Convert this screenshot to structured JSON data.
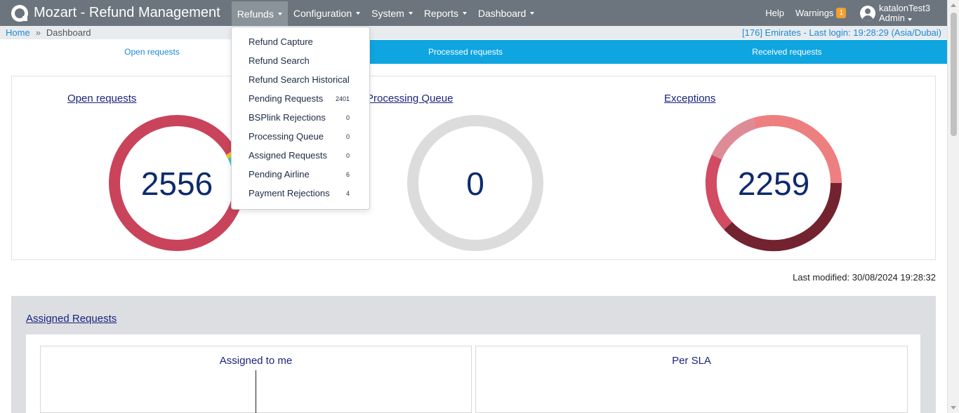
{
  "header": {
    "title": "Mozart - Refund Management",
    "menu": [
      {
        "label": "Refunds",
        "active": true
      },
      {
        "label": "Configuration"
      },
      {
        "label": "System"
      },
      {
        "label": "Reports"
      },
      {
        "label": "Dashboard"
      }
    ],
    "help": "Help",
    "warnings_label": "Warnings",
    "warnings_count": "1",
    "user_name": "katalonTest3",
    "user_role": "Admin"
  },
  "breadcrumb": {
    "home": "Home",
    "separator": "»",
    "current": "Dashboard",
    "login_info": "[176] Emirates - Last login: 19:28:29 (Asia/Dubai)"
  },
  "tabs": [
    "Open requests",
    "Processed requests",
    "Received requests"
  ],
  "refunds_dropdown": [
    {
      "label": "Refund Capture",
      "count": ""
    },
    {
      "label": "Refund Search",
      "count": ""
    },
    {
      "label": "Refund Search Historical",
      "count": ""
    },
    {
      "label": "Pending Requests",
      "count": "2401"
    },
    {
      "label": "BSPlink Rejections",
      "count": "0"
    },
    {
      "label": "Processing Queue",
      "count": "0"
    },
    {
      "label": "Assigned Requests",
      "count": "0"
    },
    {
      "label": "Pending Airline",
      "count": "6"
    },
    {
      "label": "Payment Rejections",
      "count": "4"
    }
  ],
  "summary": {
    "open": {
      "title": "Open requests",
      "value": "2556"
    },
    "processing": {
      "title": "Processing Queue",
      "value": "0"
    },
    "exceptions": {
      "title": "Exceptions",
      "value": "2259"
    }
  },
  "colors": {
    "open_main": "#c9435b",
    "open_yellow": "#f2c22e",
    "open_cyan": "#27c9d6",
    "processing_ring": "#dcdcdc",
    "exc_light": "#ee7f80",
    "exc_pink": "#de8b98",
    "exc_mid": "#d24b62",
    "exc_dark": "#72232f"
  },
  "last_modified": "Last modified: 30/08/2024 19:28:32",
  "assigned": {
    "title": "Assigned Requests",
    "panel_left": "Assigned to me",
    "panel_right": "Per SLA"
  }
}
